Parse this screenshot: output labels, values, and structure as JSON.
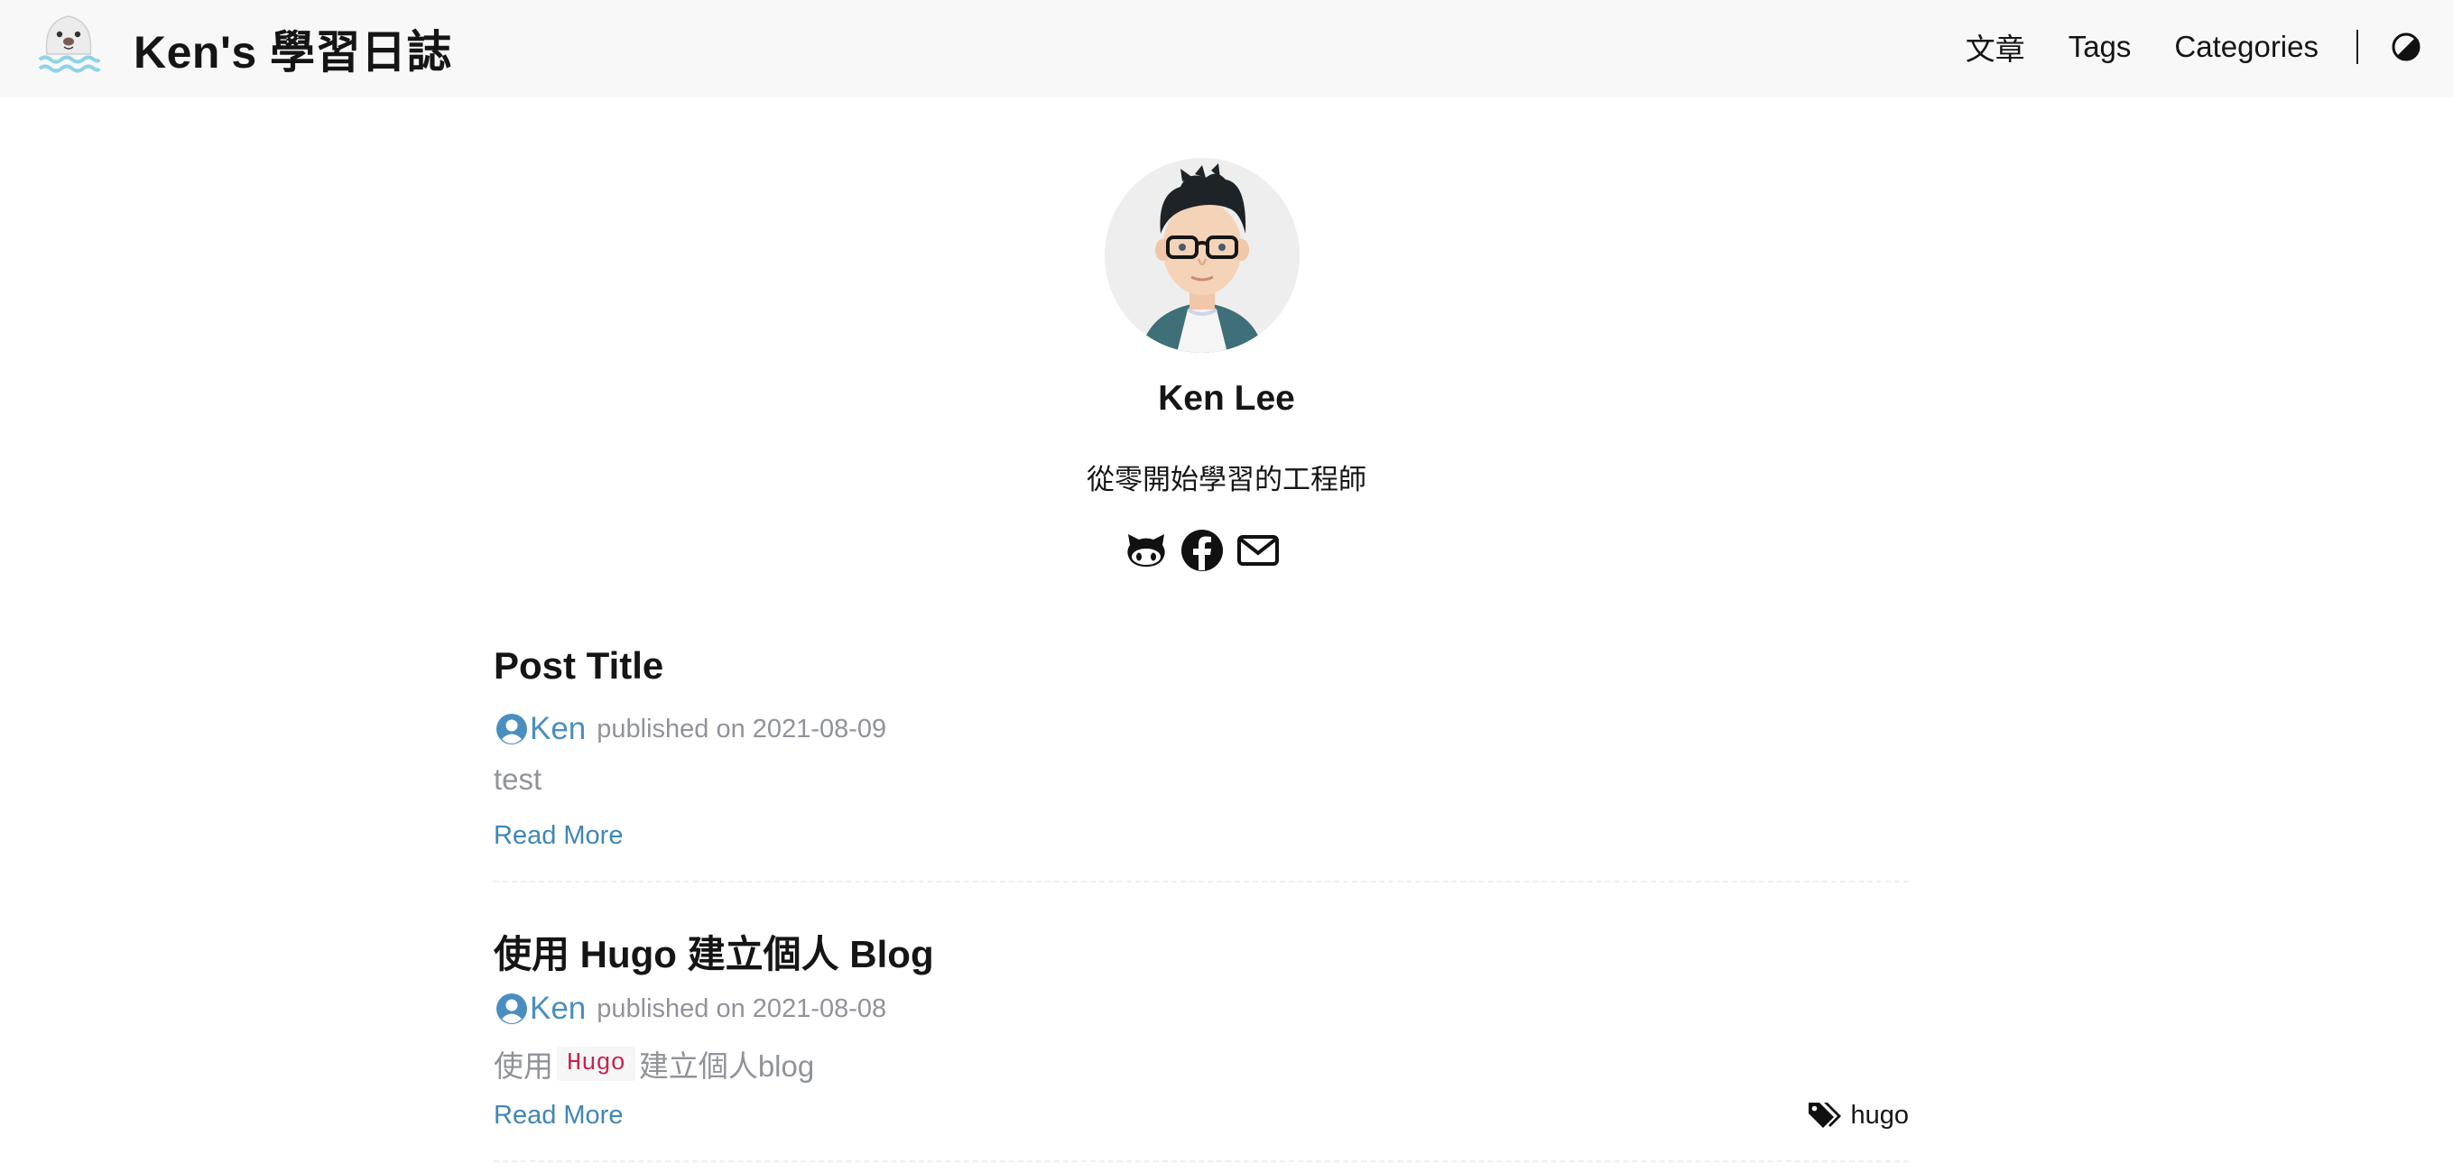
{
  "header": {
    "site_title": "Ken's 學習日誌",
    "nav": [
      {
        "label": "文章"
      },
      {
        "label": "Tags"
      },
      {
        "label": "Categories"
      }
    ],
    "icons": {
      "logo": "seal-logo",
      "theme_toggle": "contrast-icon"
    }
  },
  "profile": {
    "name": "Ken Lee",
    "subtitle": "從零開始學習的工程師",
    "social": [
      {
        "icon": "github-icon"
      },
      {
        "icon": "facebook-icon"
      },
      {
        "icon": "email-icon"
      }
    ]
  },
  "posts": [
    {
      "title": "Post Title",
      "author": "Ken",
      "published": "published on 2021-08-09",
      "summary": "test",
      "read_more": "Read More",
      "tags": []
    },
    {
      "title": "使用 Hugo 建立個人 Blog",
      "author": "Ken",
      "published": "published on 2021-08-08",
      "summary_before": "使用",
      "summary_code": "Hugo",
      "summary_after": "建立個人blog",
      "read_more": "Read More",
      "tags": [
        "hugo"
      ]
    }
  ],
  "colors": {
    "header_bg": "#f8f8f8",
    "link": "#3f86b7",
    "author": "#4a8ec1",
    "muted": "#909399",
    "code": "#c7254e"
  }
}
